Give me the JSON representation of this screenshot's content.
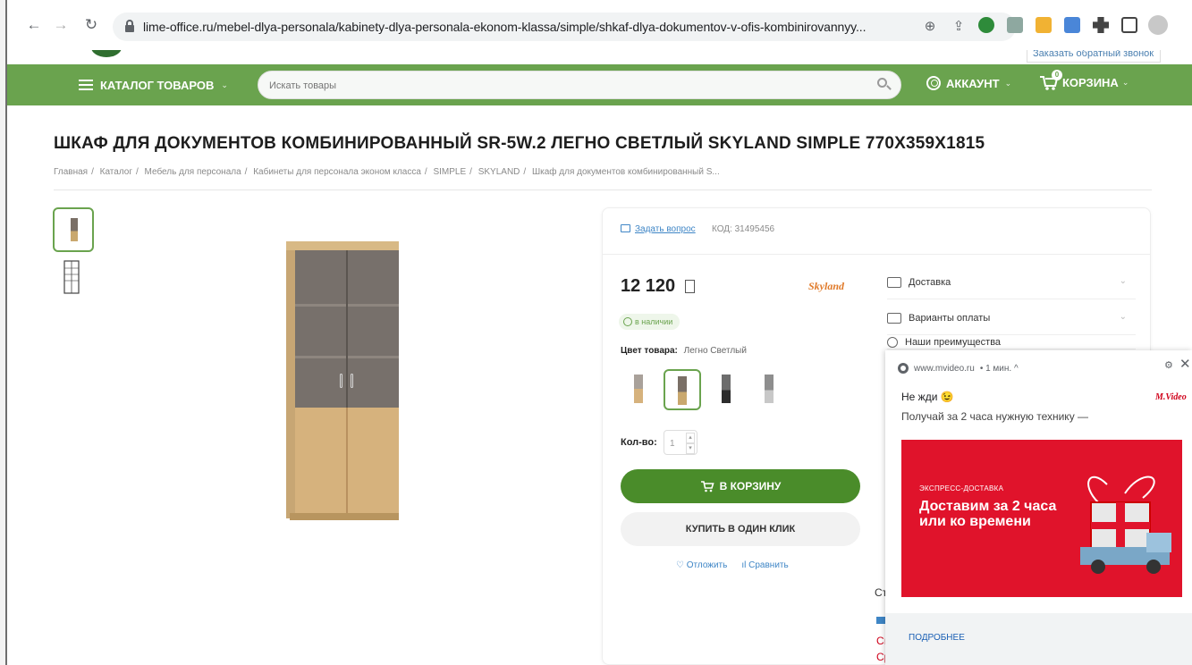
{
  "browser": {
    "url": "lime-office.ru/mebel-dlya-personala/kabinety-dlya-personala-ekonom-klassa/simple/shkaf-dlya-dokumentov-v-ofis-kombinirovannyy...",
    "icons": [
      "back-icon",
      "forward-icon",
      "reload-icon",
      "lock-icon",
      "zoom-icon",
      "share-icon",
      "star-icon",
      "extension-icons",
      "profile-icon",
      "kebab-menu-icon"
    ]
  },
  "site": {
    "callback_link": "Заказать обратный звонок",
    "menu": {
      "catalog": "КАТАЛОГ ТОВАРОВ",
      "search_placeholder": "Искать товары",
      "account": "АККАУНТ",
      "cart": "КОРЗИНА",
      "cart_count": "0",
      "caret": "⌄"
    }
  },
  "product": {
    "title": "ШКАФ ДЛЯ ДОКУМЕНТОВ КОМБИНИРОВАННЫЙ SR-5W.2 ЛЕГНО СВЕТЛЫЙ SKYLAND SIMPLE 770Х359Х1815",
    "breadcrumbs": [
      "Главная",
      "Каталог",
      "Мебель для персонала",
      "Кабинеты для персонала эконом класса",
      "SIMPLE",
      "SKYLAND",
      "Шкаф для документов комбинированный S..."
    ],
    "ask_question": "Задать вопрос",
    "code": "КОД: 31495456",
    "price": "12 120",
    "brand": "Skyland",
    "in_stock": "в наличии",
    "color_label": "Цвет товара:",
    "color_value": "Легно Светлый",
    "qty_label": "Кол-во:",
    "qty_value": "1",
    "add_to_cart": "В КОРЗИНУ",
    "one_click": "КУПИТЬ В ОДИН КЛИК",
    "defer": "Отложить",
    "compare": "Сравнить",
    "options": [
      {
        "label": "Доставка"
      },
      {
        "label": "Варианты оплаты"
      },
      {
        "label": "Наши преимущества"
      }
    ],
    "peek": {
      "a": "Ст",
      "b": "Сı",
      "c": "Ср"
    }
  },
  "popup": {
    "source": "www.mvideo.ru",
    "time": "• 1 мин. ^",
    "title": "Не жди 😉",
    "body": "Получай за 2 часа нужную технику —",
    "logo": "M.Video",
    "banner_small": "ЭКСПРЕСС-ДОСТАВКА",
    "banner_big": "Доставим за 2 часа или ко времени",
    "more": "ПОДРОБНЕЕ"
  },
  "colors": {
    "green": "#6aa34e",
    "cart_green": "#4a8c2a",
    "link": "#3f86c6",
    "mvideo_red": "#e0132b"
  }
}
